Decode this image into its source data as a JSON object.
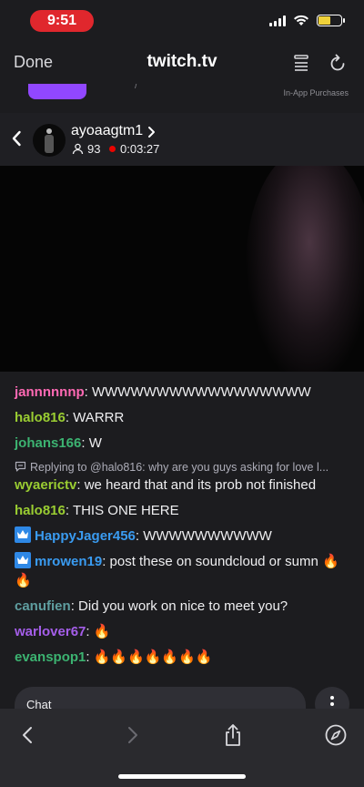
{
  "status_bar": {
    "time": "9:51"
  },
  "header": {
    "done_label": "Done",
    "site": "twitch.tv"
  },
  "banner": {
    "iap_label": "In-App Purchases",
    "partial_text": "/"
  },
  "stream": {
    "channel": "ayoaagtm1",
    "viewers": "93",
    "uptime": "0:03:27"
  },
  "chat": {
    "messages": [
      {
        "user": "jannnnnnp",
        "color": "#ff69b4",
        "text": ": WWWWWWWWWWWWWWWWW"
      },
      {
        "user": "halo816",
        "color": "#9acd32",
        "text": ": WARRR"
      },
      {
        "user": "johans166",
        "color": "#2e8b57",
        "text": ": W"
      },
      {
        "reply": "Replying to @halo816: why are you guys asking for love l..."
      },
      {
        "user": "wyaerictv",
        "color": "#9acd32",
        "text": ": we heard that and its prob not finished"
      },
      {
        "user": "halo816",
        "color": "#9acd32",
        "text": ": THIS ONE HERE"
      },
      {
        "user": "HappyJager456",
        "color": "#1e90ff",
        "badge": "crown-badge-icon",
        "text": ": WWWWWWWWWW"
      },
      {
        "user": "mrowen19",
        "color": "#1e90ff",
        "badge": "crown-badge-icon",
        "text": ": post these on soundcloud or sumn 🔥 🔥"
      },
      {
        "user": "canufien",
        "color": "#5f9ea0",
        "text": ": Did you work on nice to meet you?"
      },
      {
        "user": "warlover67",
        "color": "#8a2be2",
        "text": ": 🔥"
      },
      {
        "user": "evanspop1",
        "color": "#2e8b57",
        "text": ": 🔥🔥🔥🔥🔥🔥🔥"
      }
    ],
    "input_placeholder": "Chat"
  },
  "icons": {
    "reader": "reader-view-icon",
    "reload": "reload-icon",
    "back": "back-arrow-icon",
    "forward": "forward-arrow-icon",
    "share": "share-icon",
    "compass": "compass-icon"
  }
}
